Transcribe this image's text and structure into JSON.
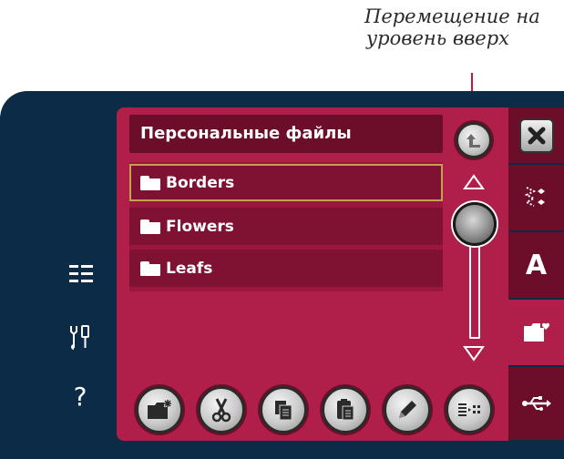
{
  "callout": {
    "line1": "Перемещение на",
    "line2": "уровень вверх"
  },
  "browser": {
    "header_title": "Персональные файлы",
    "folders": [
      {
        "label": "Borders",
        "icon": "folder-icon",
        "selected": true
      },
      {
        "label": "Flowers",
        "icon": "folder-icon",
        "selected": false
      },
      {
        "label": "Leafs",
        "icon": "folder-icon",
        "selected": false
      }
    ],
    "up_button_icon": "arrow-up-level-icon"
  },
  "left_sidebar": {
    "items": [
      {
        "icon": "list-icon"
      },
      {
        "icon": "tools-icon"
      },
      {
        "icon": "help-icon",
        "glyph": "?"
      }
    ]
  },
  "right_tabs": [
    {
      "icon": "close-icon"
    },
    {
      "icon": "stitch-icon"
    },
    {
      "icon": "font-icon",
      "glyph": "A"
    },
    {
      "icon": "personal-folder-icon",
      "active": true
    },
    {
      "icon": "usb-icon"
    }
  ],
  "bottom_toolbar": [
    {
      "icon": "new-folder-icon"
    },
    {
      "icon": "cut-icon"
    },
    {
      "icon": "copy-icon"
    },
    {
      "icon": "paste-icon"
    },
    {
      "icon": "edit-icon"
    },
    {
      "icon": "list-view-icon"
    }
  ],
  "colors": {
    "frame": "#0b2b47",
    "panel": "#b01e4a",
    "header": "#6c0d29",
    "row": "#7f1233",
    "selection_border": "#c4a04f",
    "callout_line": "#c8163a"
  }
}
